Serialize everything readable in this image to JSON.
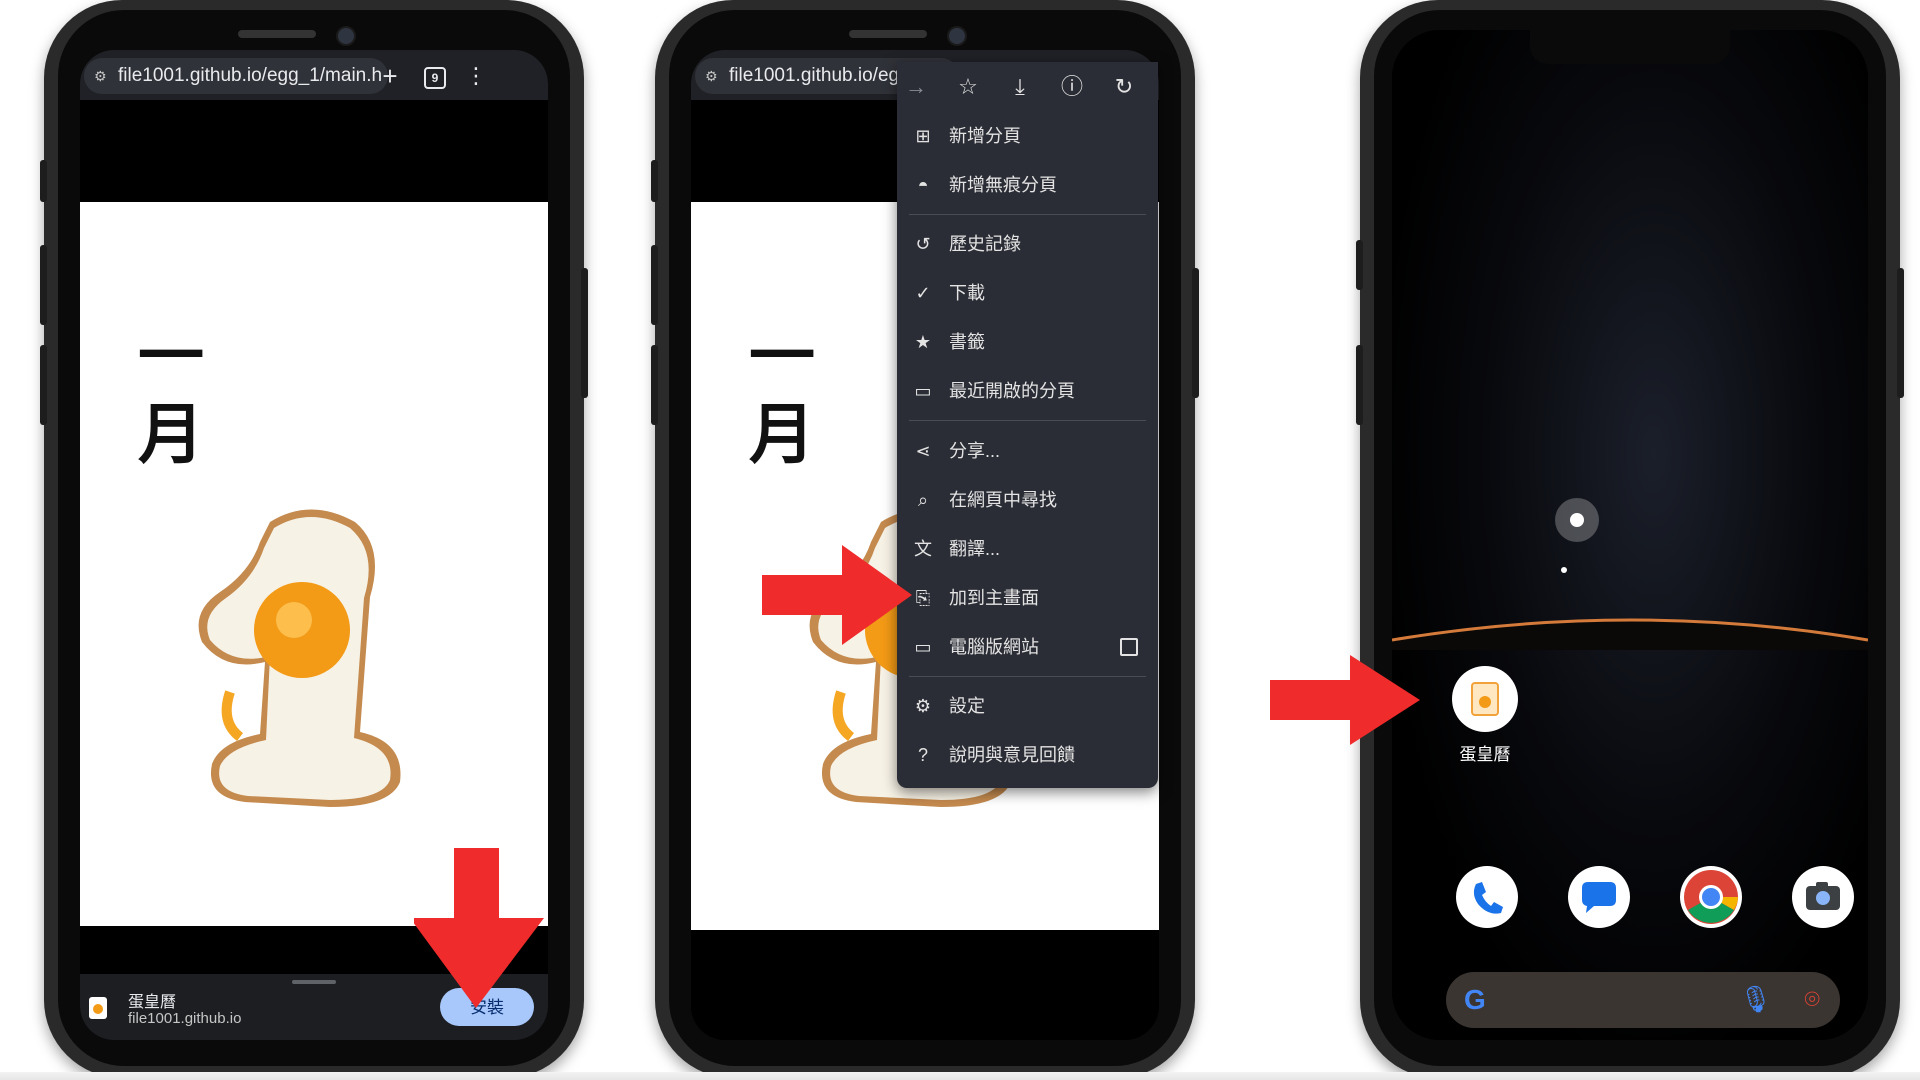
{
  "colors": {
    "arrow_red": "#ef2b2b",
    "install_button_bg": "#a8c7fa",
    "menu_bg": "#2b2d36",
    "browser_bar": "#1f2126"
  },
  "phone1": {
    "url": "file1001.github.io/egg_1/main.h",
    "tab_count": "9",
    "month_line1": "一",
    "month_line2": "月",
    "install_bar": {
      "app_name": "蛋皇曆",
      "app_url": "file1001.github.io",
      "install_label": "安裝"
    }
  },
  "phone2": {
    "url": "file1001.github.io/eg",
    "month_line1": "一",
    "month_line2": "月",
    "menu_icons": [
      "forward-icon",
      "star-icon",
      "download-icon",
      "info-icon",
      "refresh-icon"
    ],
    "menu_items": [
      {
        "label": "新增分頁",
        "icon": "new-tab-icon"
      },
      {
        "label": "新增無痕分頁",
        "icon": "incognito-icon"
      },
      {
        "label": "歷史記錄",
        "icon": "history-icon"
      },
      {
        "label": "下載",
        "icon": "download-check-icon"
      },
      {
        "label": "書籤",
        "icon": "bookmark-star-icon"
      },
      {
        "label": "最近開啟的分頁",
        "icon": "devices-icon"
      },
      {
        "label": "分享...",
        "icon": "share-icon"
      },
      {
        "label": "在網頁中尋找",
        "icon": "find-in-page-icon"
      },
      {
        "label": "翻譯...",
        "icon": "translate-icon"
      },
      {
        "label": "加到主畫面",
        "icon": "add-to-home-icon"
      },
      {
        "label": "電腦版網站",
        "icon": "desktop-icon"
      },
      {
        "label": "設定",
        "icon": "settings-gear-icon"
      },
      {
        "label": "說明與意見回饋",
        "icon": "help-icon"
      }
    ]
  },
  "phone3": {
    "home_app_label": "蛋皇曆",
    "dock": [
      "phone-app-icon",
      "messages-app-icon",
      "chrome-app-icon",
      "camera-app-icon"
    ],
    "search_bar_icons": [
      "google-g-icon",
      "microphone-icon",
      "google-lens-icon"
    ]
  }
}
